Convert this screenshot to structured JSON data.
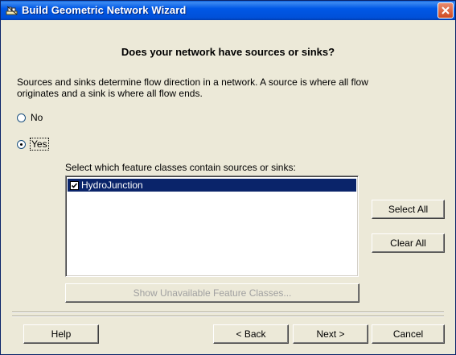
{
  "window": {
    "title": "Build Geometric Network Wizard"
  },
  "header": {
    "question": "Does your network have sources or sinks?"
  },
  "description": "Sources and sinks determine flow direction in a network. A source is where all flow originates and a sink is where all flow ends.",
  "options": {
    "no_label": "No",
    "yes_label": "Yes",
    "selected": "Yes"
  },
  "feature_classes": {
    "label": "Select which feature classes contain sources or sinks:",
    "items": [
      {
        "label": "HydroJunction",
        "checked": true,
        "selected": true
      }
    ]
  },
  "buttons": {
    "select_all": "Select All",
    "clear_all": "Clear All",
    "show_unavailable": "Show Unavailable Feature Classes...",
    "help": "Help",
    "back": "< Back",
    "next": "Next >",
    "cancel": "Cancel"
  },
  "icons": {
    "title": "network-wizard-icon",
    "close": "close-icon"
  },
  "colors": {
    "titlebar": "#0058e6",
    "selection": "#0a246a",
    "dialog_bg": "#ece9d8"
  }
}
